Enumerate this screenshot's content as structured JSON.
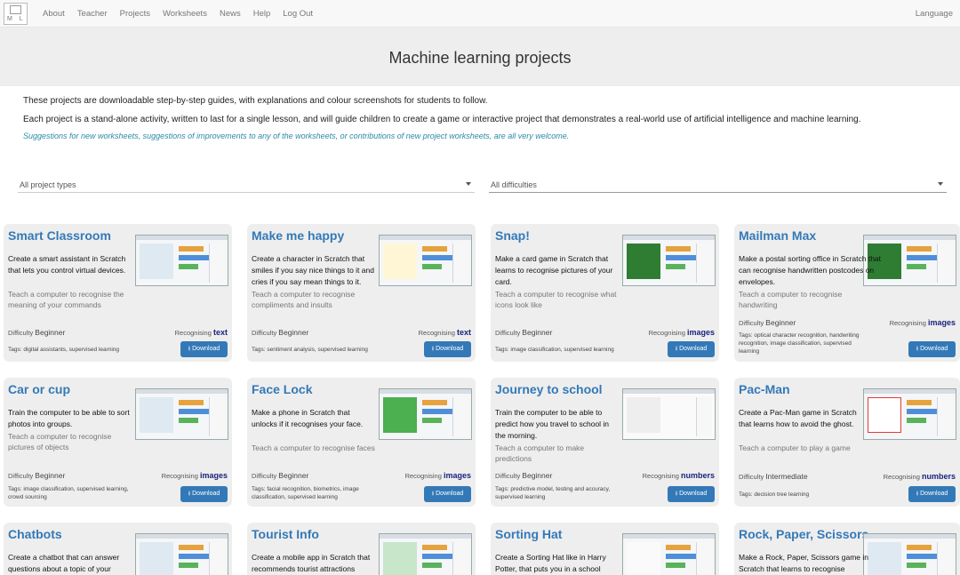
{
  "nav": {
    "logo_text": "M L",
    "links": [
      "About",
      "Teacher",
      "Projects",
      "Worksheets",
      "News",
      "Help",
      "Log Out"
    ],
    "language": "Language"
  },
  "hero": {
    "title": "Machine learning projects"
  },
  "intro": {
    "p1": "These projects are downloadable step-by-step guides, with explanations and colour screenshots for students to follow.",
    "p2": "Each project is a stand-alone activity, written to last for a single lesson, and will guide children to create a game or interactive project that demonstrates a real-world use of artificial intelligence and machine learning.",
    "suggestion": "Suggestions for new worksheets, suggestions of improvements to any of the worksheets, or contributions of new project worksheets, are all very welcome."
  },
  "filters": {
    "types": "All project types",
    "difficulties": "All difficulties"
  },
  "labels": {
    "difficulty": "Difficulty",
    "recognising": "Recognising",
    "tags": "Tags",
    "download": "Download"
  },
  "cards": [
    {
      "title": "Smart Classroom",
      "desc": "Create a smart assistant in Scratch that lets you control virtual devices.",
      "teach": "Teach a computer to recognise the meaning of your commands",
      "difficulty": "Beginner",
      "recognising": "text",
      "tags": "digital assistants, supervised learning"
    },
    {
      "title": "Make me happy",
      "desc": "Create a character in Scratch that smiles if you say nice things to it and cries if you say mean things to it.",
      "teach": "Teach a computer to recognise compliments and insults",
      "difficulty": "Beginner",
      "recognising": "text",
      "tags": "sentiment analysis, supervised learning"
    },
    {
      "title": "Snap!",
      "desc": "Make a card game in Scratch that learns to recognise pictures of your card.",
      "teach": "Teach a computer to recognise what icons look like",
      "difficulty": "Beginner",
      "recognising": "images",
      "tags": "image classification, supervised learning"
    },
    {
      "title": "Mailman Max",
      "desc": "Make a postal sorting office in Scratch that can recognise handwritten postcodes on envelopes.",
      "teach": "Teach a computer to recognise handwriting",
      "difficulty": "Beginner",
      "recognising": "images",
      "tags": "optical character recognition, handwriting recognition, image classification, supervised learning"
    },
    {
      "title": "Car or cup",
      "desc": "Train the computer to be able to sort photos into groups.",
      "teach": "Teach a computer to recognise pictures of objects",
      "difficulty": "Beginner",
      "recognising": "images",
      "tags": "image classification, supervised learning, crowd sourcing"
    },
    {
      "title": "Face Lock",
      "desc": "Make a phone in Scratch that unlocks if it recognises your face.",
      "teach": "Teach a computer to recognise faces",
      "difficulty": "Beginner",
      "recognising": "images",
      "tags": "facial recognition, biometrics, image classification, supervised learning"
    },
    {
      "title": "Journey to school",
      "desc": "Train the computer to be able to predict how you travel to school in the morning.",
      "teach": "Teach a computer to make predictions",
      "difficulty": "Beginner",
      "recognising": "numbers",
      "tags": "predictive model, testing and accuracy, supervised learning"
    },
    {
      "title": "Pac-Man",
      "desc": "Create a Pac-Man game in Scratch that learns how to avoid the ghost.",
      "teach": "Teach a computer to play a game",
      "difficulty": "Intermediate",
      "recognising": "numbers",
      "tags": "decision tree learning"
    },
    {
      "title": "Chatbots",
      "desc": "Create a chatbot that can answer questions about a topic of your"
    },
    {
      "title": "Tourist Info",
      "desc": "Create a mobile app in Scratch that recommends tourist attractions based"
    },
    {
      "title": "Sorting Hat",
      "desc": "Create a Sorting Hat like in Harry Potter, that puts you in a school"
    },
    {
      "title": "Rock, Paper, Scissors",
      "desc": "Make a Rock, Paper, Scissors game in Scratch that learns to recognise"
    }
  ]
}
